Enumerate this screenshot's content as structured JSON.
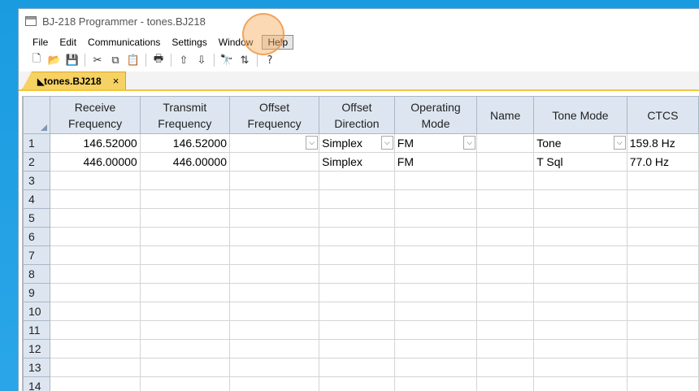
{
  "window": {
    "title": "BJ-218 Programmer - tones.BJ218"
  },
  "menu": [
    "File",
    "Edit",
    "Communications",
    "Settings",
    "Window",
    "Help"
  ],
  "toolbar": [
    {
      "name": "new-file-icon",
      "glyph": "🗋"
    },
    {
      "name": "open-folder-icon",
      "glyph": "📂"
    },
    {
      "name": "save-icon",
      "glyph": "💾"
    },
    {
      "sep": true
    },
    {
      "name": "cut-icon",
      "glyph": "✂"
    },
    {
      "name": "copy-icon",
      "glyph": "⧉"
    },
    {
      "name": "paste-icon",
      "glyph": "📋"
    },
    {
      "sep": true
    },
    {
      "name": "print-icon",
      "glyph": "🖶"
    },
    {
      "sep": true
    },
    {
      "name": "move-up-icon",
      "glyph": "⇧"
    },
    {
      "name": "move-down-icon",
      "glyph": "⇩"
    },
    {
      "sep": true
    },
    {
      "name": "find-icon",
      "glyph": "🔭"
    },
    {
      "name": "sort-icon",
      "glyph": "⇅"
    },
    {
      "sep": true
    },
    {
      "name": "help-icon",
      "glyph": "?"
    }
  ],
  "tab": {
    "label": "tones.BJ218",
    "close": "×"
  },
  "grid": {
    "columns": [
      {
        "label": "Receive Frequency",
        "width": 113
      },
      {
        "label": "Transmit Frequency",
        "width": 113
      },
      {
        "label": "Offset Frequency",
        "width": 113
      },
      {
        "label": "Offset Direction",
        "width": 95
      },
      {
        "label": "Operating Mode",
        "width": 104
      },
      {
        "label": "Name",
        "width": 72
      },
      {
        "label": "Tone Mode",
        "width": 120
      },
      {
        "label": "CTCS",
        "width": 90
      }
    ],
    "rows": [
      [
        "146.52000",
        "146.52000",
        "",
        "Simplex",
        "FM",
        "",
        "Tone",
        "159.8 Hz"
      ],
      [
        "446.00000",
        "446.00000",
        "",
        "Simplex",
        "FM",
        "",
        "T Sql",
        "77.0 Hz"
      ],
      [
        "",
        "",
        "",
        "",
        "",
        "",
        "",
        ""
      ],
      [
        "",
        "",
        "",
        "",
        "",
        "",
        "",
        ""
      ],
      [
        "",
        "",
        "",
        "",
        "",
        "",
        "",
        ""
      ],
      [
        "",
        "",
        "",
        "",
        "",
        "",
        "",
        ""
      ],
      [
        "",
        "",
        "",
        "",
        "",
        "",
        "",
        ""
      ],
      [
        "",
        "",
        "",
        "",
        "",
        "",
        "",
        ""
      ],
      [
        "",
        "",
        "",
        "",
        "",
        "",
        "",
        ""
      ],
      [
        "",
        "",
        "",
        "",
        "",
        "",
        "",
        ""
      ],
      [
        "",
        "",
        "",
        "",
        "",
        "",
        "",
        ""
      ],
      [
        "",
        "",
        "",
        "",
        "",
        "",
        "",
        ""
      ],
      [
        "",
        "",
        "",
        "",
        "",
        "",
        "",
        ""
      ],
      [
        "",
        "",
        "",
        "",
        "",
        "",
        "",
        ""
      ]
    ],
    "dropdown_row": 0,
    "dropdown_cols": [
      2,
      3,
      4,
      6
    ]
  }
}
